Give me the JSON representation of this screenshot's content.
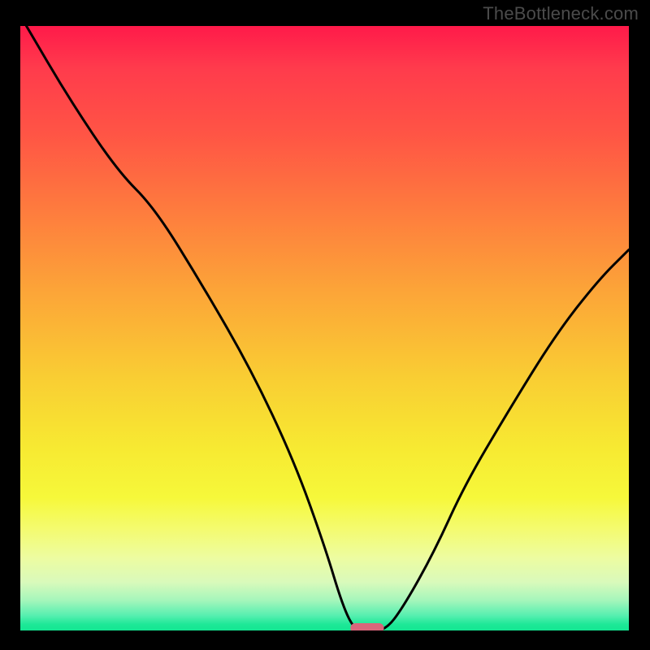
{
  "watermark": "TheBottleneck.com",
  "chart_data": {
    "type": "line",
    "title": "",
    "xlabel": "",
    "ylabel": "",
    "xlim": [
      0,
      100
    ],
    "ylim": [
      0,
      100
    ],
    "gradient_stops": [
      {
        "offset": 0,
        "color": "#ff1a4a"
      },
      {
        "offset": 7,
        "color": "#ff3b4c"
      },
      {
        "offset": 18,
        "color": "#ff5545"
      },
      {
        "offset": 30,
        "color": "#fe7a3e"
      },
      {
        "offset": 44,
        "color": "#fca538"
      },
      {
        "offset": 58,
        "color": "#f9cd33"
      },
      {
        "offset": 70,
        "color": "#f7ea32"
      },
      {
        "offset": 78,
        "color": "#f6f83a"
      },
      {
        "offset": 83,
        "color": "#f4fb6d"
      },
      {
        "offset": 88,
        "color": "#edfca1"
      },
      {
        "offset": 92,
        "color": "#d9fabb"
      },
      {
        "offset": 95,
        "color": "#a5f6bb"
      },
      {
        "offset": 97.5,
        "color": "#57efb0"
      },
      {
        "offset": 99,
        "color": "#1de897"
      },
      {
        "offset": 100,
        "color": "#14e692"
      }
    ],
    "series": [
      {
        "name": "bottleneck-curve",
        "x": [
          1,
          8,
          16,
          22,
          30,
          38,
          45,
          50,
          53,
          55,
          57,
          60,
          63,
          68,
          73,
          80,
          88,
          95,
          100
        ],
        "values": [
          100,
          88,
          76,
          70,
          57,
          43,
          28,
          14,
          4,
          0,
          0,
          0,
          4,
          13,
          24,
          36,
          49,
          58,
          63
        ]
      }
    ],
    "marker": {
      "name": "optimal-zone",
      "x_center": 57,
      "y": 0,
      "width": 5.5,
      "color": "#d9667b"
    },
    "colors": {
      "curve": "#000000",
      "background": "#000000",
      "pill": "#d9667b"
    }
  }
}
